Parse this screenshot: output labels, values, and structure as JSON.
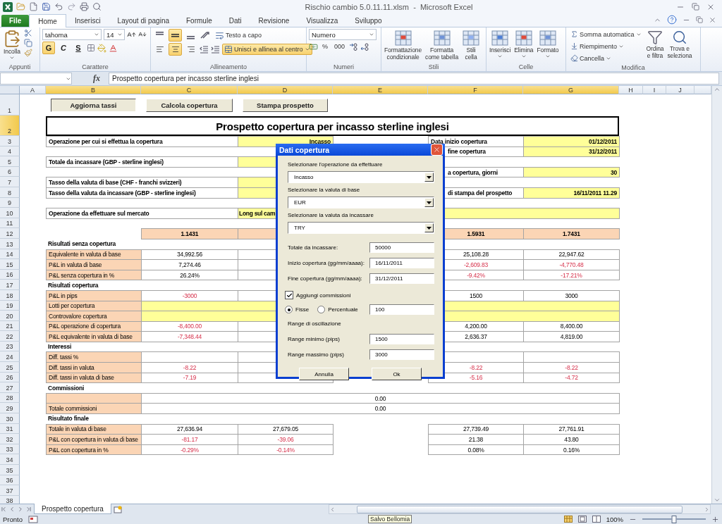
{
  "title_bar": {
    "title": "Rischio cambio 5.0.11.11.xlsm  -  Microsoft Excel"
  },
  "ribbon_tabs": [
    {
      "label": "File",
      "kind": "file",
      "selected": false
    },
    {
      "label": "Home",
      "kind": "tab",
      "selected": true
    },
    {
      "label": "Inserisci",
      "kind": "tab",
      "selected": false
    },
    {
      "label": "Layout di pagina",
      "kind": "tab",
      "selected": false
    },
    {
      "label": "Formule",
      "kind": "tab",
      "selected": false
    },
    {
      "label": "Dati",
      "kind": "tab",
      "selected": false
    },
    {
      "label": "Revisione",
      "kind": "tab",
      "selected": false
    },
    {
      "label": "Visualizza",
      "kind": "tab",
      "selected": false
    },
    {
      "label": "Sviluppo",
      "kind": "tab",
      "selected": false
    }
  ],
  "ribbon": {
    "clipboard": {
      "label": "Appunti",
      "paste": "Incolla"
    },
    "font": {
      "label": "Carattere",
      "face": "tahoma",
      "size": "14",
      "styles": [
        {
          "label": "G",
          "on": true
        },
        {
          "label": "C",
          "on": false
        },
        {
          "label": "S",
          "on": false
        }
      ]
    },
    "alignment": {
      "label": "Allineamento",
      "vertical": [
        {
          "on": false
        },
        {
          "on": true
        },
        {
          "on": false
        }
      ],
      "horizontal": [
        {
          "on": false
        },
        {
          "on": true
        },
        {
          "on": false
        }
      ],
      "wrap": "Testo a capo",
      "merge": {
        "label": "Unisci e allinea al centro",
        "on": true
      }
    },
    "number": {
      "label": "Numeri",
      "format": "Numero",
      "percent": "%",
      "thousands": "000"
    },
    "styles": {
      "label": "Stili",
      "buttons": [
        "Formattazione\ncondizionale",
        "Formatta\ncome tabella",
        "Stili\ncella"
      ]
    },
    "cells": {
      "label": "Celle",
      "buttons": [
        "Inserisci",
        "Elimina",
        "Formato"
      ]
    },
    "editing": {
      "label": "Modifica",
      "small": [
        "Somma automatica",
        "Riempimento",
        "Cancella"
      ],
      "large": [
        "Ordina\ne filtra",
        "Trova e\nseleziona"
      ]
    }
  },
  "formula_bar": {
    "function_label": "fx",
    "formula": "Prospetto copertura per incasso sterline inglesi"
  },
  "sheet": {
    "columns": [
      {
        "label": "A",
        "selected": false
      },
      {
        "label": "B",
        "selected": true
      },
      {
        "label": "C",
        "selected": true
      },
      {
        "label": "D",
        "selected": true
      },
      {
        "label": "E",
        "selected": true
      },
      {
        "label": "F",
        "selected": true
      },
      {
        "label": "G",
        "selected": true
      },
      {
        "label": "H",
        "selected": false
      },
      {
        "label": "I",
        "selected": false
      },
      {
        "label": "J",
        "selected": false
      }
    ],
    "rows": [
      {
        "number": "1",
        "selected": false,
        "cells": [
          "",
          {
            "kind": "button",
            "text": "Aggiorna tassi"
          },
          {
            "kind": "button",
            "text": "Calcola copertura"
          },
          {
            "kind": "button",
            "text": "Stampa prospetto"
          }
        ]
      },
      {
        "number": "2",
        "selected": true,
        "title": "Prospetto copertura per incasso sterline inglesi",
        "cells": []
      },
      {
        "number": "3",
        "selected": false,
        "cells": [
          "",
          {
            "kind": "field",
            "text": "Operazione per cui si effettua  la copertura"
          },
          {
            "kind": "merged"
          },
          {
            "kind": "input",
            "text": "Incasso"
          },
          "",
          {
            "kind": "field",
            "text": "Data inizio copertura"
          },
          {
            "kind": "input",
            "text": "01/12/2011"
          }
        ]
      },
      {
        "number": "4",
        "selected": false,
        "cells": [
          "",
          "",
          "",
          "",
          "",
          {
            "kind": "covered",
            "text": "fine copertura"
          },
          {
            "kind": "input",
            "text": "31/12/2011"
          }
        ]
      },
      {
        "number": "5",
        "selected": false,
        "cells": [
          "",
          {
            "kind": "field",
            "text": "Totale da incassare (GBP - sterline inglesi)"
          },
          {
            "kind": "merged"
          },
          {
            "kind": "input"
          }
        ]
      },
      {
        "number": "6",
        "selected": false,
        "cells": [
          "",
          "",
          "",
          "",
          "",
          {
            "kind": "covered",
            "text": "a copertura, giorni"
          },
          {
            "kind": "input",
            "text": "30"
          }
        ]
      },
      {
        "number": "7",
        "selected": false,
        "cells": [
          "",
          {
            "kind": "field",
            "text": "Tasso della valuta di base (CHF - franchi svizzeri)"
          },
          {
            "kind": "merged"
          },
          {
            "kind": "input"
          }
        ]
      },
      {
        "number": "8",
        "selected": false,
        "cells": [
          "",
          {
            "kind": "field",
            "text": "Tasso della valuta da incassare (GBP - sterline inglesi)"
          },
          {
            "kind": "merged"
          },
          {
            "kind": "input"
          },
          "",
          {
            "kind": "covered",
            "text": "di stampa del prospetto"
          },
          {
            "kind": "input",
            "text": "16/11/2011 11.29"
          }
        ]
      },
      {
        "number": "9",
        "selected": false,
        "cells": []
      },
      {
        "number": "10",
        "selected": false,
        "cells": [
          "",
          {
            "kind": "field",
            "text": "Operazione da effettuare sul mercato"
          },
          {
            "kind": "merged"
          },
          {
            "kind": "note",
            "text": "Long sul cam"
          },
          {
            "kind": "merged"
          },
          {
            "kind": "merged"
          },
          {
            "kind": "merged"
          }
        ]
      },
      {
        "number": "11",
        "selected": false,
        "cells": []
      },
      {
        "number": "12",
        "selected": false,
        "cells": [
          "",
          "",
          {
            "kind": "rate",
            "text": "1.1431"
          },
          {
            "kind": "rate"
          },
          "",
          {
            "kind": "rate",
            "text": "1.5931"
          },
          {
            "kind": "rate",
            "text": "1.7431"
          }
        ]
      },
      {
        "number": "13",
        "selected": false,
        "cells": [
          "",
          {
            "kind": "section",
            "text": "Risultati senza copertura"
          }
        ]
      },
      {
        "number": "14",
        "selected": false,
        "cells": [
          "",
          {
            "kind": "label",
            "text": "Equivalente in valuta di base"
          },
          {
            "kind": "value",
            "text": "34,992.56"
          },
          {
            "kind": "value"
          },
          "",
          {
            "kind": "value",
            "text": "25,108.28"
          },
          {
            "kind": "value",
            "text": "22,947.62"
          }
        ]
      },
      {
        "number": "15",
        "selected": false,
        "cells": [
          "",
          {
            "kind": "label",
            "text": "P&L in valuta di base"
          },
          {
            "kind": "value",
            "text": "7,274.46"
          },
          "",
          "",
          {
            "kind": "negative",
            "text": "-2,609.83"
          },
          {
            "kind": "negative",
            "text": "-4,770.48"
          }
        ]
      },
      {
        "number": "16",
        "selected": false,
        "cells": [
          "",
          {
            "kind": "label",
            "text": "P&L senza copertura in %"
          },
          {
            "kind": "value",
            "text": "26.24%"
          },
          {
            "kind": "value"
          },
          "",
          {
            "kind": "negative",
            "text": "-9.42%"
          },
          {
            "kind": "negative",
            "text": "-17.21%"
          }
        ]
      },
      {
        "number": "17",
        "selected": false,
        "cells": [
          "",
          {
            "kind": "section",
            "text": "Risultati copertura"
          }
        ]
      },
      {
        "number": "18",
        "selected": false,
        "cells": [
          "",
          {
            "kind": "label",
            "text": "P&L in pips"
          },
          {
            "kind": "negative",
            "text": "-3000"
          },
          {
            "kind": "value"
          },
          "",
          {
            "kind": "value",
            "text": "1500"
          },
          {
            "kind": "value",
            "text": "3000"
          }
        ]
      },
      {
        "number": "19",
        "selected": false,
        "cells": [
          "",
          {
            "kind": "label",
            "text": "Lotti per copertura"
          },
          {
            "kind": "input"
          },
          {
            "kind": "merged"
          },
          {
            "kind": "merged"
          },
          {
            "kind": "merged"
          },
          {
            "kind": "merged"
          }
        ]
      },
      {
        "number": "20",
        "selected": false,
        "cells": [
          "",
          {
            "kind": "label",
            "text": "Controvalore copertura"
          },
          {
            "kind": "input"
          },
          {
            "kind": "merged"
          },
          {
            "kind": "merged"
          },
          {
            "kind": "merged"
          },
          {
            "kind": "merged"
          }
        ]
      },
      {
        "number": "21",
        "selected": false,
        "cells": [
          "",
          {
            "kind": "label",
            "text": "P&L operazione di copertura"
          },
          {
            "kind": "negative",
            "text": "-8,400.00"
          },
          "",
          "",
          {
            "kind": "value",
            "text": "4,200.00"
          },
          {
            "kind": "value",
            "text": "8,400.00"
          }
        ]
      },
      {
        "number": "22",
        "selected": false,
        "cells": [
          "",
          {
            "kind": "label",
            "text": "P&L equivalente in valuta di base"
          },
          {
            "kind": "negative",
            "text": "-7,348.44"
          },
          {
            "kind": "value"
          },
          "",
          {
            "kind": "value",
            "text": "2,636.37"
          },
          {
            "kind": "value",
            "text": "4,819.00"
          }
        ]
      },
      {
        "number": "23",
        "selected": false,
        "cells": [
          "",
          {
            "kind": "section",
            "text": "Interessi"
          }
        ]
      },
      {
        "number": "24",
        "selected": false,
        "cells": [
          "",
          {
            "kind": "label",
            "text": "Diff. tassi %"
          },
          {
            "kind": "value"
          },
          {
            "kind": "value"
          },
          "",
          {
            "kind": "value"
          },
          {
            "kind": "value"
          }
        ]
      },
      {
        "number": "25",
        "selected": false,
        "cells": [
          "",
          {
            "kind": "label",
            "text": "Diff. tassi in valuta"
          },
          {
            "kind": "negative",
            "text": "-8.22"
          },
          "",
          "",
          {
            "kind": "negative",
            "text": "-8.22"
          },
          {
            "kind": "negative",
            "text": "-8.22"
          }
        ]
      },
      {
        "number": "26",
        "selected": false,
        "cells": [
          "",
          {
            "kind": "label",
            "text": "Diff. tassi in valuta di base"
          },
          {
            "kind": "negative",
            "text": "-7.19"
          },
          {
            "kind": "value"
          },
          "",
          {
            "kind": "negative",
            "text": "-5.16"
          },
          {
            "kind": "negative",
            "text": "-4.72"
          }
        ]
      },
      {
        "number": "27",
        "selected": false,
        "cells": [
          "",
          {
            "kind": "section",
            "text": "Commissioni"
          }
        ]
      },
      {
        "number": "28",
        "selected": false,
        "cells": [
          "",
          {
            "kind": "label"
          },
          {
            "kind": "value",
            "text": "0.00"
          },
          {
            "kind": "merged"
          },
          {
            "kind": "merged"
          },
          {
            "kind": "merged"
          },
          {
            "kind": "merged"
          }
        ]
      },
      {
        "number": "29",
        "selected": false,
        "cells": [
          "",
          {
            "kind": "label",
            "text": "Totale commissioni"
          },
          {
            "kind": "value",
            "text": "0.00"
          },
          {
            "kind": "merged"
          },
          {
            "kind": "merged"
          },
          {
            "kind": "merged"
          },
          {
            "kind": "merged"
          }
        ]
      },
      {
        "number": "30",
        "selected": false,
        "cells": [
          "",
          {
            "kind": "section",
            "text": "Risultato finale"
          }
        ]
      },
      {
        "number": "31",
        "selected": false,
        "cells": [
          "",
          {
            "kind": "label",
            "text": "Totale in valuta di base"
          },
          {
            "kind": "value",
            "text": "27,636.94"
          },
          {
            "kind": "value",
            "text": "27,679.05"
          },
          "",
          {
            "kind": "value",
            "text": "27,739.49"
          },
          {
            "kind": "value",
            "text": "27,761.91"
          }
        ]
      },
      {
        "number": "32",
        "selected": false,
        "cells": [
          "",
          {
            "kind": "label",
            "text": "P&L con copertura in valuta di base"
          },
          {
            "kind": "negative",
            "text": "-81.17"
          },
          {
            "kind": "negative",
            "text": "-39.06"
          },
          "",
          {
            "kind": "value",
            "text": "21.38"
          },
          {
            "kind": "value",
            "text": "43.80"
          }
        ]
      },
      {
        "number": "33",
        "selected": false,
        "cells": [
          "",
          {
            "kind": "label",
            "text": "P&L con copertura in %"
          },
          {
            "kind": "negative",
            "text": "-0.29%"
          },
          {
            "kind": "negative",
            "text": "-0.14%"
          },
          "",
          {
            "kind": "value",
            "text": "0.08%"
          },
          {
            "kind": "value",
            "text": "0.16%"
          }
        ]
      },
      {
        "number": "34",
        "selected": false,
        "cells": []
      },
      {
        "number": "35",
        "selected": false,
        "cells": []
      },
      {
        "number": "36",
        "selected": false,
        "cells": []
      },
      {
        "number": "37",
        "selected": false,
        "cells": []
      },
      {
        "number": "38",
        "selected": false,
        "cells": []
      }
    ]
  },
  "dialog": {
    "title": "Dati copertura",
    "combos": [
      {
        "label": "Selezionare l'operazione da effettuare",
        "value": "Incasso"
      },
      {
        "label": "Selezionare la valuta di base",
        "value": "EUR"
      },
      {
        "label": "Selezionare la valuta da incassare",
        "value": "TRY"
      }
    ],
    "fields": [
      {
        "label": "Totale da incassare:",
        "value": "50000"
      },
      {
        "label": "Inizio copertura (gg/mm/aaaa):",
        "value": "16/11/2011"
      },
      {
        "label": "Fine copertura (gg/mm/aaaa):",
        "value": "31/12/2011"
      }
    ],
    "commission": {
      "label": "Aggiungi commissioni",
      "checked": true
    },
    "commission_types": [
      {
        "label": "Fisse",
        "selected": true
      },
      {
        "label": "Percentuale",
        "selected": false
      }
    ],
    "commission_value": "100",
    "range_heading": "Range di oscillazione",
    "range_fields": [
      {
        "label": "Range minimo (pips)",
        "value": "1500"
      },
      {
        "label": "Range massimo (pips)",
        "value": "3000"
      }
    ],
    "buttons": [
      "Annulla",
      "Ok"
    ]
  },
  "sheet_tabs": [
    {
      "label": "Prospetto copertura",
      "selected": true
    }
  ],
  "status_bar": {
    "status": "Pronto",
    "tooltip": "Salvo Bellomia",
    "zoom": "100%",
    "zoom_slider": {
      "level": 0.5
    }
  }
}
